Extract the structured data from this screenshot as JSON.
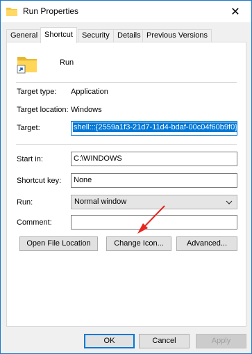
{
  "window": {
    "title": "Run Properties",
    "close_glyph": "✕"
  },
  "tabs": [
    {
      "label": "General"
    },
    {
      "label": "Shortcut"
    },
    {
      "label": "Security"
    },
    {
      "label": "Details"
    },
    {
      "label": "Previous Versions"
    }
  ],
  "shortcut": {
    "name": "Run",
    "target_type_label": "Target type:",
    "target_type_value": "Application",
    "target_location_label": "Target location:",
    "target_location_value": "Windows",
    "target_label": "Target:",
    "target_value": "shell:::{2559a1f3-21d7-11d4-bdaf-00c04f60b9f0}",
    "start_in_label": "Start in:",
    "start_in_value": "C:\\WINDOWS",
    "shortcut_key_label": "Shortcut key:",
    "shortcut_key_value": "None",
    "run_label": "Run:",
    "run_value": "Normal window",
    "comment_label": "Comment:",
    "comment_value": ""
  },
  "buttons": {
    "open_file_location": "Open File Location",
    "change_icon": "Change Icon...",
    "advanced": "Advanced..."
  },
  "footer": {
    "ok": "OK",
    "cancel": "Cancel",
    "apply": "Apply"
  },
  "colors": {
    "accent": "#0078d7",
    "annotation_arrow": "#e8261f"
  }
}
